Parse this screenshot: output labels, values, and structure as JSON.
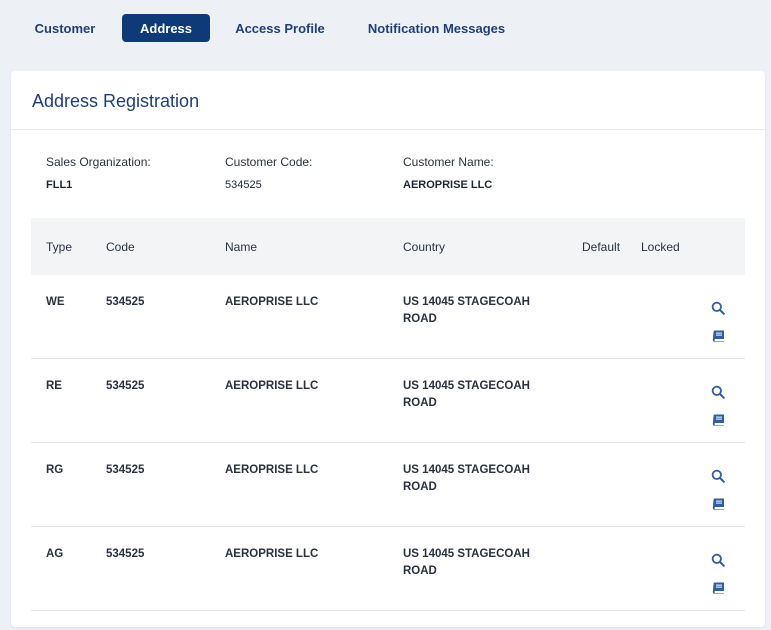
{
  "tabs": [
    {
      "label": "Customer",
      "active": false
    },
    {
      "label": "Address",
      "active": true
    },
    {
      "label": "Access Profile",
      "active": false
    },
    {
      "label": "Notification Messages",
      "active": false
    }
  ],
  "card": {
    "title": "Address Registration"
  },
  "info": {
    "sales_org_label": "Sales Organization:",
    "sales_org_value": "FLL1",
    "customer_code_label": "Customer Code:",
    "customer_code_value": "534525",
    "customer_name_label": "Customer Name:",
    "customer_name_value": "AEROPRISE LLC"
  },
  "table": {
    "headers": {
      "type": "Type",
      "code": "Code",
      "name": "Name",
      "country": "Country",
      "default": "Default",
      "locked": "Locked"
    },
    "rows": [
      {
        "type": "WE",
        "code": "534525",
        "name": "AEROPRISE LLC",
        "country": "US 14045 STAGECOAH ROAD"
      },
      {
        "type": "RE",
        "code": "534525",
        "name": "AEROPRISE LLC",
        "country": "US 14045 STAGECOAH ROAD"
      },
      {
        "type": "RG",
        "code": "534525",
        "name": "AEROPRISE LLC",
        "country": "US 14045 STAGECOAH ROAD"
      },
      {
        "type": "AG",
        "code": "534525",
        "name": "AEROPRISE LLC",
        "country": "US 14045 STAGECOAH ROAD"
      }
    ]
  },
  "icons": {
    "row_actions": [
      "search-icon",
      "book-icon"
    ]
  },
  "colors": {
    "accent": "#0f3a78",
    "link": "#1f3f7a",
    "icon": "#2e5ea8",
    "background": "#edf1f6"
  }
}
